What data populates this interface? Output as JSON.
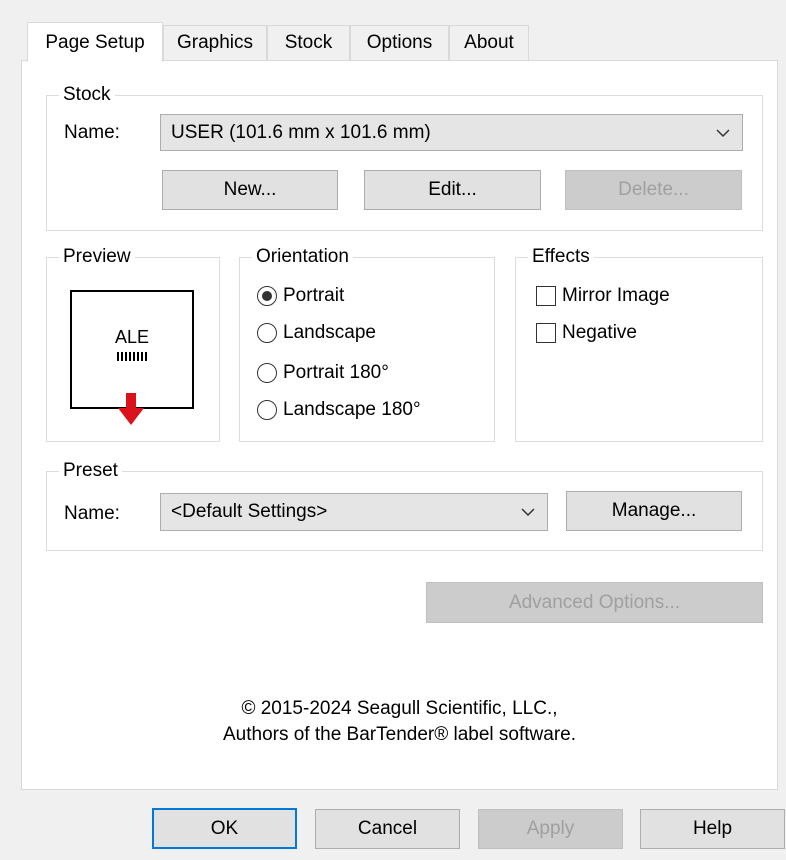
{
  "tabs": [
    {
      "label": "Page Setup",
      "active": true
    },
    {
      "label": "Graphics",
      "active": false
    },
    {
      "label": "Stock",
      "active": false
    },
    {
      "label": "Options",
      "active": false
    },
    {
      "label": "About",
      "active": false
    }
  ],
  "stock": {
    "legend": "Stock",
    "name_label": "Name:",
    "name_value": "USER (101.6 mm x 101.6 mm)",
    "new_label": "New...",
    "edit_label": "Edit...",
    "delete_label": "Delete..."
  },
  "preview": {
    "legend": "Preview",
    "sample_text": "ALE",
    "arrow_color": "#d9121b"
  },
  "orientation": {
    "legend": "Orientation",
    "options": [
      "Portrait",
      "Landscape",
      "Portrait 180°",
      "Landscape 180°"
    ],
    "selected": "Portrait"
  },
  "effects": {
    "legend": "Effects",
    "mirror_label": "Mirror Image",
    "negative_label": "Negative",
    "mirror_checked": false,
    "negative_checked": false
  },
  "preset": {
    "legend": "Preset",
    "name_label": "Name:",
    "name_value": "<Default Settings>",
    "manage_label": "Manage..."
  },
  "advanced_label": "Advanced Options...",
  "copyright": {
    "line1": "© 2015-2024 Seagull Scientific, LLC.,",
    "line2": "Authors of the BarTender® label software."
  },
  "footer": {
    "ok": "OK",
    "cancel": "Cancel",
    "apply": "Apply",
    "help": "Help"
  },
  "colors": {
    "accent": "#0078d7",
    "arrow": "#d9121b"
  }
}
